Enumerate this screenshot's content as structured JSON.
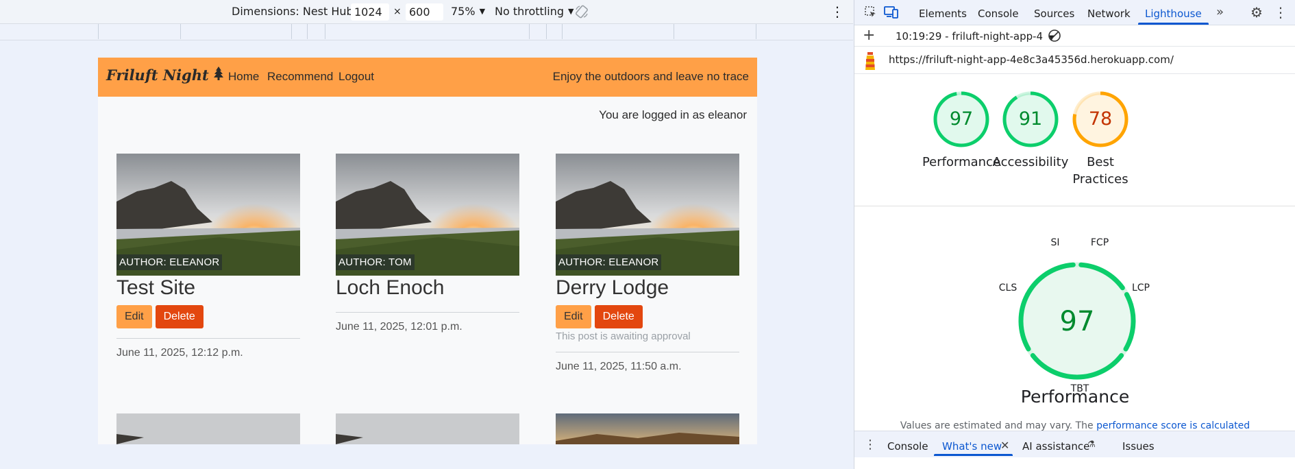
{
  "device_toolbar": {
    "dimensions_label": "Dimensions: Nest Hub",
    "width": "1024",
    "times": "×",
    "height": "600",
    "zoom": "75%",
    "throttling": "No throttling"
  },
  "site": {
    "brand": "Friluft Night",
    "nav": [
      "Home",
      "Recommend",
      "Logout"
    ],
    "tagline": "Enjoy the outdoors and leave no trace",
    "login_status": "You are logged in as eleanor",
    "posts": [
      {
        "author": "AUTHOR: ELEANOR",
        "title": "Test Site",
        "edit": "Edit",
        "delete": "Delete",
        "pending": "",
        "date": "June 11, 2025, 12:12 p.m."
      },
      {
        "author": "AUTHOR: TOM",
        "title": "Loch Enoch",
        "edit": "",
        "delete": "",
        "pending": "",
        "date": "June 11, 2025, 12:01 p.m."
      },
      {
        "author": "AUTHOR: ELEANOR",
        "title": "Derry Lodge",
        "edit": "Edit",
        "delete": "Delete",
        "pending": "This post is awaiting approval",
        "date": "June 11, 2025, 11:50 a.m."
      }
    ]
  },
  "devtools": {
    "tabs": [
      "Elements",
      "Console",
      "Sources",
      "Network",
      "Lighthouse"
    ],
    "active_tab": "Lighthouse",
    "report_selector": "10:19:29 - friluft-night-app-4",
    "url": "https://friluft-night-app-4e8c3a45356d.herokuapp.com/",
    "scores": [
      {
        "label": "Performance",
        "value": "97",
        "color": "#0cce6b",
        "text_color": "#008a2e",
        "fill": 0.97
      },
      {
        "label": "Accessibility",
        "value": "91",
        "color": "#0cce6b",
        "text_color": "#008a2e",
        "fill": 0.91
      },
      {
        "label": "Best Practices",
        "value": "78",
        "color": "#ffa400",
        "text_color": "#c33300",
        "fill": 0.78
      }
    ],
    "big_gauge": {
      "value": "97",
      "metrics": [
        "SI",
        "FCP",
        "LCP",
        "TBT",
        "CLS"
      ],
      "title": "Performance"
    },
    "note_text": "Values are estimated and may vary. The",
    "note_link": "performance score is calculated",
    "drawer_tabs": [
      "Console",
      "What's new",
      "AI assistance",
      "Issues"
    ],
    "drawer_active": "What's new"
  }
}
